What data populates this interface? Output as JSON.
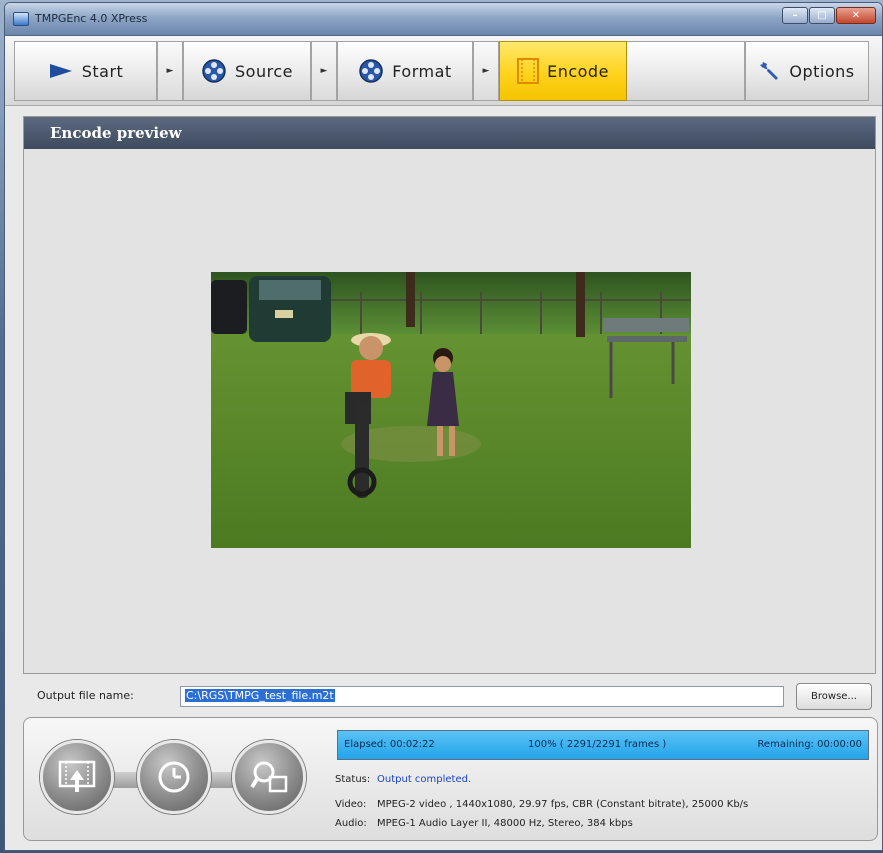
{
  "window": {
    "title": "TMPGEnc 4.0 XPress"
  },
  "toolbar": {
    "steps": [
      {
        "label": "Start",
        "icon": "play-arrow-icon"
      },
      {
        "label": "Source",
        "icon": "film-reel-icon"
      },
      {
        "label": "Format",
        "icon": "film-reel-icon"
      },
      {
        "label": "Encode",
        "icon": "filmstrip-icon",
        "active": true
      }
    ],
    "options_label": "Options",
    "accent": "#ffd21c"
  },
  "panel": {
    "title": "Encode preview"
  },
  "output": {
    "label": "Output file name:",
    "value": "C:\\RGS\\TMPG_test_file.m2t",
    "browse_label": "Browse..."
  },
  "progress": {
    "elapsed": "Elapsed: 00:02:22",
    "percent_text": "100% ( 2291/2291  frames )",
    "remaining": "Remaining: 00:00:00",
    "percent": 100
  },
  "status": {
    "status_label": "Status:",
    "status_value": "Output completed.",
    "video_label": "Video:",
    "video_value": "MPEG-2 video , 1440x1080, 29.97 fps, CBR (Constant bitrate), 25000 Kb/s",
    "audio_label": "Audio:",
    "audio_value": "MPEG-1 Audio Layer II, 48000 Hz, Stereo, 384 kbps"
  },
  "controls": [
    "encode-output-icon",
    "clock-icon",
    "preview-magnifier-icon"
  ]
}
